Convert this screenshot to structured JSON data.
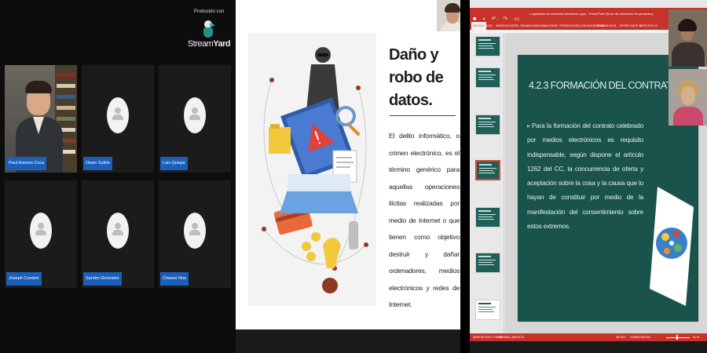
{
  "streamyard": {
    "produced_by": "Producido con",
    "logo_stream": "Stream",
    "logo_yard": "Yard",
    "participants": [
      {
        "name": "Paul Antonio Coca",
        "camera": "on"
      },
      {
        "name": "Owen Sotillo",
        "camera": "off"
      },
      {
        "name": "Luis Quispe",
        "camera": "off"
      },
      {
        "name": "Joseph Condori",
        "camera": "off"
      },
      {
        "name": "Sandro Gonzales",
        "camera": "off"
      },
      {
        "name": "Chavez Noe",
        "camera": "off"
      }
    ]
  },
  "shared_slide": {
    "title": "Daño y robo de datos.",
    "body": "El delito informático, o crimen electrónico, es el término genérico para aquellas operaciones ilícitas realizadas por medio de Internet o que tienen como objetivo destruir y dañar ordenadores, medios electrónicos y redes de Internet."
  },
  "powerpoint": {
    "window_title": "Legislación de comercio electrónico.pptx - PowerPoint (Error de activación de productos)",
    "tabs": [
      "ARCHIVO",
      "INICIO",
      "INSERTAR",
      "DISEÑO",
      "TRANSICIONES",
      "ANIMACIONES",
      "PRESENTACIÓN CON DIAPOSITIVAS",
      "REVISAR",
      "VISTA",
      "OFFPRO SUITE 10",
      "NITRO PRO 10"
    ],
    "active_tab": "ARCHIVO",
    "slide_count_thumbs": 7,
    "selected_thumb": 4,
    "slide": {
      "title": "4.2.3 FORMACIÓN DEL CONTRATO",
      "bullet": "Para la formación del contrato celebrado por medios electrónicos es requisito indispensable, según dispone el artículo 1262 del CC, la concurrencia de oferta y aceptación sobre la cosa y la causa que lo hayan de constituir por medio de la manifestación del consentimiento sobre estos extremos."
    },
    "status": {
      "slide_info": "DIAPOSITIVA 17 DE 26",
      "language": "ESPAÑOL (MÉXICO)",
      "notes": "NOTAS",
      "comments": "COMENTARIOS",
      "zoom": "61 %"
    },
    "colors": {
      "accent": "#c7332a",
      "slide_bg": "#19534c"
    }
  }
}
